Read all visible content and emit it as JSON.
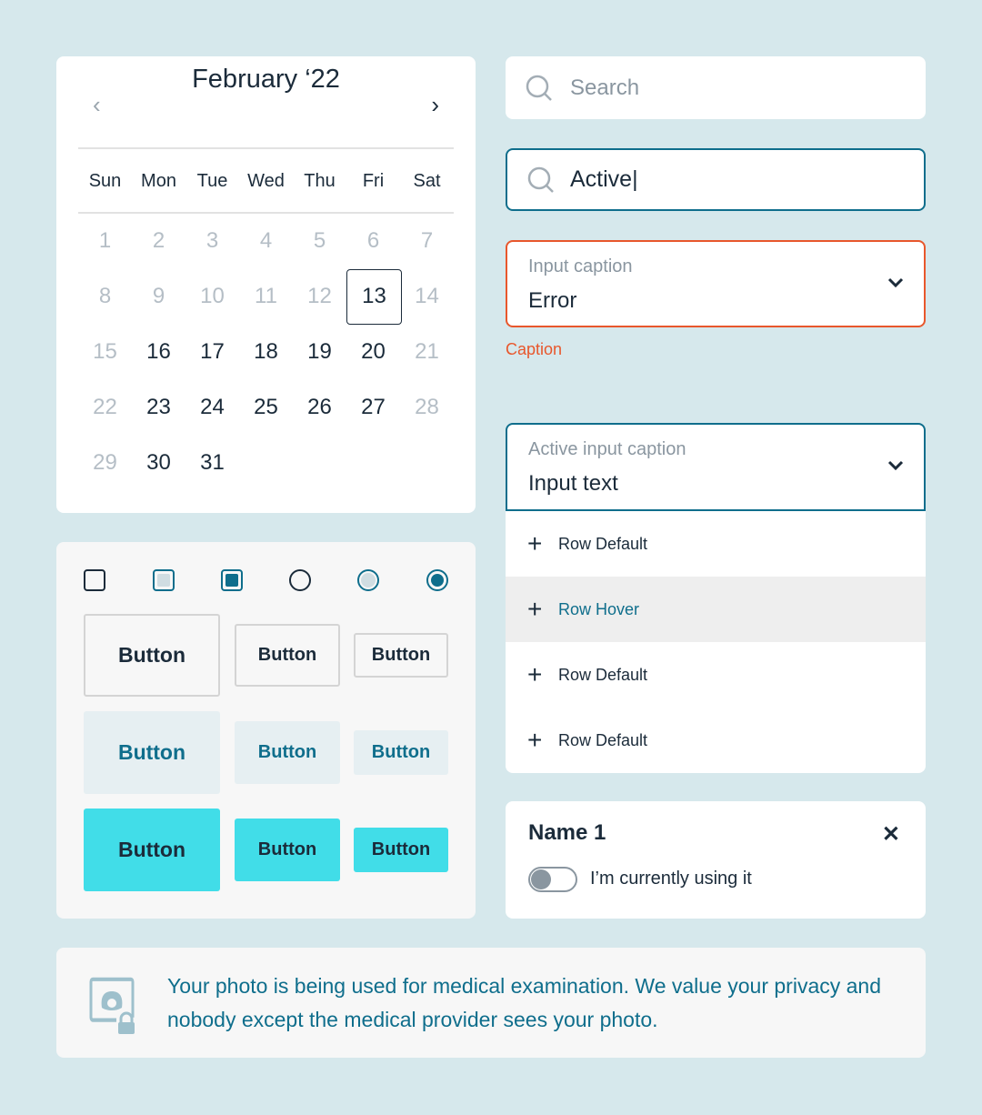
{
  "calendar": {
    "title": "February ‘22",
    "prev": "‹",
    "next": "›",
    "weekdays": [
      "Sun",
      "Mon",
      "Tue",
      "Wed",
      "Thu",
      "Fri",
      "Sat"
    ],
    "days": [
      {
        "d": "1",
        "m": 1
      },
      {
        "d": "2",
        "m": 1
      },
      {
        "d": "3",
        "m": 1
      },
      {
        "d": "4",
        "m": 1
      },
      {
        "d": "5",
        "m": 1
      },
      {
        "d": "6",
        "m": 1
      },
      {
        "d": "7",
        "m": 1
      },
      {
        "d": "8",
        "m": 1
      },
      {
        "d": "9",
        "m": 1
      },
      {
        "d": "10",
        "m": 1
      },
      {
        "d": "11",
        "m": 1
      },
      {
        "d": "12",
        "m": 1
      },
      {
        "d": "13",
        "m": 0,
        "sel": 1
      },
      {
        "d": "14",
        "m": 1
      },
      {
        "d": "15",
        "m": 1
      },
      {
        "d": "16",
        "m": 0
      },
      {
        "d": "17",
        "m": 0
      },
      {
        "d": "18",
        "m": 0
      },
      {
        "d": "19",
        "m": 0
      },
      {
        "d": "20",
        "m": 0
      },
      {
        "d": "21",
        "m": 1
      },
      {
        "d": "22",
        "m": 1
      },
      {
        "d": "23",
        "m": 0
      },
      {
        "d": "24",
        "m": 0
      },
      {
        "d": "25",
        "m": 0
      },
      {
        "d": "26",
        "m": 0
      },
      {
        "d": "27",
        "m": 0
      },
      {
        "d": "28",
        "m": 1
      },
      {
        "d": "29",
        "m": 1
      },
      {
        "d": "30",
        "m": 0
      },
      {
        "d": "31",
        "m": 0
      }
    ]
  },
  "buttons": {
    "label": "Button"
  },
  "search": {
    "placeholder": "Search",
    "active_value": "Active|"
  },
  "error_field": {
    "caption": "Input caption",
    "value": "Error",
    "helper": "Caption"
  },
  "dropdown": {
    "caption": "Active input caption",
    "value": "Input text",
    "rows": [
      "Row Default",
      "Row Hover",
      "Row Default",
      "Row Default"
    ]
  },
  "name_card": {
    "title": "Name 1",
    "toggle_label": "I’m currently using it",
    "toggle_on": false
  },
  "banner": {
    "text": "Your photo is being used for medical examination. We value your privacy and nobody except the medical provider sees your photo."
  },
  "colors": {
    "bg": "#d6e8ec",
    "teal": "#0f6e8c",
    "cyan": "#41dde8",
    "error": "#e8572c"
  }
}
